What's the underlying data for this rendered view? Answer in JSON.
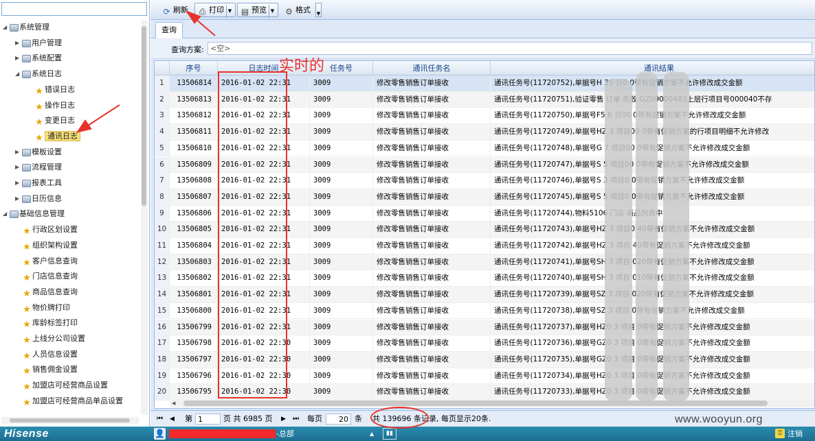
{
  "tree": {
    "items": [
      {
        "label": "系统管理",
        "level": 0,
        "expanded": true,
        "icon": "folder-icon"
      },
      {
        "label": "用户管理",
        "level": 1,
        "expanded": false,
        "icon": "folder-icon"
      },
      {
        "label": "系统配置",
        "level": 1,
        "expanded": false,
        "icon": "folder-icon"
      },
      {
        "label": "系统日志",
        "level": 1,
        "expanded": true,
        "icon": "folder-icon"
      },
      {
        "label": "错误日志",
        "level": 2,
        "icon": "star-icon"
      },
      {
        "label": "操作日志",
        "level": 2,
        "icon": "star-icon"
      },
      {
        "label": "变更日志",
        "level": 2,
        "icon": "star-icon"
      },
      {
        "label": "通讯日志",
        "level": 2,
        "icon": "star-icon",
        "selected": true
      },
      {
        "label": "模板设置",
        "level": 1,
        "expanded": false,
        "icon": "folder-icon"
      },
      {
        "label": "流程管理",
        "level": 1,
        "expanded": false,
        "icon": "folder-icon"
      },
      {
        "label": "报表工具",
        "level": 1,
        "expanded": false,
        "icon": "folder-icon"
      },
      {
        "label": "日历信息",
        "level": 1,
        "expanded": false,
        "icon": "folder-icon"
      },
      {
        "label": "基础信息管理",
        "level": 0,
        "expanded": true,
        "icon": "folder-icon"
      },
      {
        "label": "行政区划设置",
        "level": 1,
        "icon": "star-icon"
      },
      {
        "label": "组织架构设置",
        "level": 1,
        "icon": "star-icon"
      },
      {
        "label": "客户信息查询",
        "level": 1,
        "icon": "star-icon"
      },
      {
        "label": "门店信息查询",
        "level": 1,
        "icon": "star-icon"
      },
      {
        "label": "商品信息查询",
        "level": 1,
        "icon": "star-icon"
      },
      {
        "label": "物价牌打印",
        "level": 1,
        "icon": "star-icon"
      },
      {
        "label": "库龄标签打印",
        "level": 1,
        "icon": "star-icon"
      },
      {
        "label": "上线分公司设置",
        "level": 1,
        "icon": "star-icon"
      },
      {
        "label": "人员信息设置",
        "level": 1,
        "icon": "star-icon"
      },
      {
        "label": "销售佣金设置",
        "level": 1,
        "icon": "star-icon"
      },
      {
        "label": "加盟店可经营商品设置",
        "level": 1,
        "icon": "star-icon"
      },
      {
        "label": "加盟店可经营商品单品设置",
        "level": 1,
        "icon": "star-icon"
      }
    ]
  },
  "toolbar": {
    "refresh_label": "刷新",
    "print_label": "打印",
    "preview_label": "预览",
    "format_label": "格式"
  },
  "tabs": {
    "query": "查询"
  },
  "query": {
    "label": "查询方案:",
    "value": "<空>"
  },
  "grid": {
    "headers": [
      "序号",
      "日志时间",
      "任务号",
      "通讯任务名",
      "通讯结果"
    ],
    "rows": [
      {
        "n": "1",
        "seq": "13506814",
        "time": "2016-01-02 22:31",
        "task": "3009",
        "name": "修改零售销售订单接收",
        "result": "通讯任务号(11720752),单据号H          35        日0    0带有促销方案不允许修改成交金额"
      },
      {
        "n": "2",
        "seq": "13506813",
        "time": "2016-01-02 22:31",
        "task": "3009",
        "name": "修改零售销售订单接收",
        "result": "通讯任务号(11720751),验证零售       订单          失败         GZ09000483上层行项目号000040不存"
      },
      {
        "n": "3",
        "seq": "13506812",
        "time": "2016-01-02 22:31",
        "task": "3009",
        "name": "修改零售销售订单接收",
        "result": "通讯任务号(11720750),单据号F5          6        日00      0带有促销方案不允许修改成交金额"
      },
      {
        "n": "4",
        "seq": "13506811",
        "time": "2016-01-02 22:31",
        "task": "3009",
        "name": "修改零售销售订单接收",
        "result": "通讯任务号(11720749),单据号HZ          3        项目00      0带有促销方案的行项目明细不允许修改"
      },
      {
        "n": "5",
        "seq": "13506810",
        "time": "2016-01-02 22:31",
        "task": "3009",
        "name": "修改零售销售订单接收",
        "result": "通讯任务号(11720748),单据号G          7        项目00      0带有促销方案不允许修改成交金额"
      },
      {
        "n": "6",
        "seq": "13506809",
        "time": "2016-01-02 22:31",
        "task": "3009",
        "name": "修改零售销售订单接收",
        "result": "通讯任务号(11720747),单据号S          5        项目00      0带有促销方案不允许修改成交金额"
      },
      {
        "n": "7",
        "seq": "13506808",
        "time": "2016-01-02 22:31",
        "task": "3009",
        "name": "修改零售销售订单接收",
        "result": "通讯任务号(11720746),单据号S          3        项目0       0带有促销方案不允许修改成交金额"
      },
      {
        "n": "8",
        "seq": "13506807",
        "time": "2016-01-02 22:31",
        "task": "3009",
        "name": "修改零售销售订单接收",
        "result": "通讯任务号(11720745),单据号S          5        项目0       0带有促销方案不允许修改成交金额"
      },
      {
        "n": "9",
        "seq": "13506806",
        "time": "2016-01-02 22:31",
        "task": "3009",
        "name": "修改零售销售订单接收",
        "result": "通讯任务号(11720744),物料5106                  门店     商品列表中"
      },
      {
        "n": "10",
        "seq": "13506805",
        "time": "2016-01-02 22:31",
        "task": "3009",
        "name": "修改零售销售订单接收",
        "result": "通讯任务号(11720743),单据号HZ          3        项目0      40带有促销方案不允许修改成交金额"
      },
      {
        "n": "11",
        "seq": "13506804",
        "time": "2016-01-02 22:31",
        "task": "3009",
        "name": "修改零售销售订单接收",
        "result": "通讯任务号(11720742),单据号HZ          3        项目      40带有促销方案不允许修改成交金额"
      },
      {
        "n": "12",
        "seq": "13506803",
        "time": "2016-01-02 22:31",
        "task": "3009",
        "name": "修改零售销售订单接收",
        "result": "通讯任务号(11720741),单据号SH          3        项目      020带有促销方案不允许修改成交金额"
      },
      {
        "n": "13",
        "seq": "13506802",
        "time": "2016-01-02 22:31",
        "task": "3009",
        "name": "修改零售销售订单接收",
        "result": "通讯任务号(11720740),单据号SH          3        项目      010带有促销方案不允许修改成交金额"
      },
      {
        "n": "14",
        "seq": "13506801",
        "time": "2016-01-02 22:31",
        "task": "3009",
        "name": "修改零售销售订单接收",
        "result": "通讯任务号(11720739),单据号SZ          3        项目      020带有促销方案不允许修改成交金额"
      },
      {
        "n": "15",
        "seq": "13506800",
        "time": "2016-01-02 22:31",
        "task": "3009",
        "name": "修改零售销售订单接收",
        "result": "通讯任务号(11720738),单据号SZ          3        项目      0带有促销方案不允许修改成交金额"
      },
      {
        "n": "16",
        "seq": "13506799",
        "time": "2016-01-02 22:31",
        "task": "3009",
        "name": "修改零售销售订单接收",
        "result": "通讯任务号(11720737),单据号HZ0          3        项目      0带有促销方案不允许修改成交金额"
      },
      {
        "n": "17",
        "seq": "13506798",
        "time": "2016-01-02 22:30",
        "task": "3009",
        "name": "修改零售销售订单接收",
        "result": "通讯任务号(11720736),单据号GZ0          3        项目      0带有促销方案不允许修改成交金额"
      },
      {
        "n": "18",
        "seq": "13506797",
        "time": "2016-01-02 22:30",
        "task": "3009",
        "name": "修改零售销售订单接收",
        "result": "通讯任务号(11720735),单据号GZ0          3        项目      0带有促销方案不允许修改成交金额"
      },
      {
        "n": "19",
        "seq": "13506796",
        "time": "2016-01-02 22:30",
        "task": "3009",
        "name": "修改零售销售订单接收",
        "result": "通讯任务号(11720734),单据号HZ0          3        项目      0带有促销方案不允许修改成交金额"
      },
      {
        "n": "20",
        "seq": "13506795",
        "time": "2016-01-02 22:30",
        "task": "3009",
        "name": "修改零售销售订单接收",
        "result": "通讯任务号(11720733),单据号HZ0          3        项目      0带有促销方案不允许修改成交金额"
      }
    ]
  },
  "pager": {
    "page_prefix": "第",
    "page_value": "1",
    "page_suffix": "页 共 6985 页",
    "per_page_prefix": "每页",
    "per_page_value": "20",
    "per_page_suffix": "条",
    "summary": "共 139696 条记录, 每页显示20条."
  },
  "statusbar": {
    "brand": "Hisense",
    "dept": "-总部",
    "logout_label": "注销"
  },
  "annotation": {
    "realtime_label": "实时的"
  },
  "watermark": "www.wooyun.org",
  "colors": {
    "annotation_red": "#e8322c",
    "header_text": "#15428b",
    "status_bg": "#1c6e92"
  }
}
